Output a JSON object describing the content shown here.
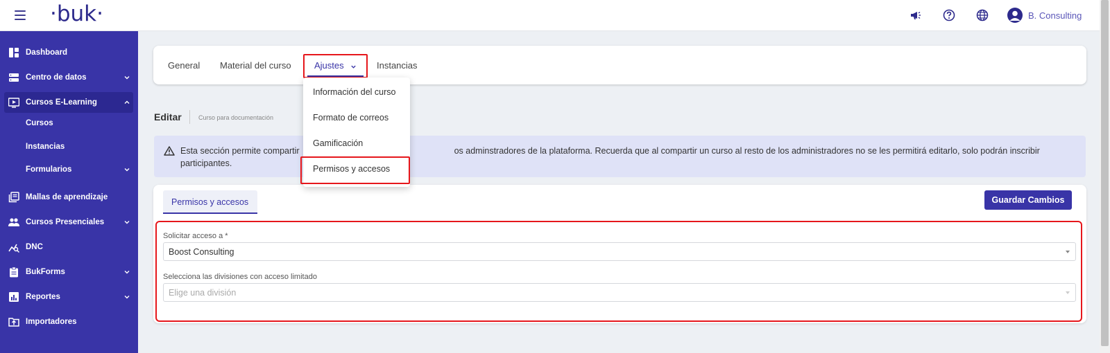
{
  "topbar": {
    "logo": "·buk·",
    "user": "B. Consulting"
  },
  "sidebar": {
    "items": [
      {
        "label": "Dashboard"
      },
      {
        "label": "Centro de datos"
      },
      {
        "label": "Cursos E-Learning"
      },
      {
        "label": "Cursos"
      },
      {
        "label": "Instancias"
      },
      {
        "label": "Formularios"
      },
      {
        "label": "Mallas de aprendizaje"
      },
      {
        "label": "Cursos Presenciales"
      },
      {
        "label": "DNC"
      },
      {
        "label": "BukForms"
      },
      {
        "label": "Reportes"
      },
      {
        "label": "Importadores"
      }
    ]
  },
  "tabs": {
    "general": "General",
    "material": "Material del curso",
    "ajustes": "Ajustes",
    "instancias": "Instancias"
  },
  "dropdown": {
    "items": [
      "Información del curso",
      "Formato de correos",
      "Gamificación",
      "Permisos y accesos"
    ]
  },
  "editar": {
    "title": "Editar",
    "subtitle": "Curso para documentación"
  },
  "alert": {
    "text_start": "Esta sección permite compartir",
    "text_end": "os adminstradores de la plataforma. Recuerda que al compartir un curso al resto de los administradores no se les permitirá editarlo, solo podrán inscribir",
    "text_line2": "participantes."
  },
  "permisos": {
    "tab": "Permisos y accesos",
    "save": "Guardar Cambios",
    "field1_label": "Solicitar acceso a *",
    "field1_value": "Boost Consulting",
    "field2_label": "Selecciona las divisiones con acceso limitado",
    "field2_placeholder": "Elige una división"
  },
  "colors": {
    "primary": "#3934a7",
    "highlight": "#e6161b",
    "alert_bg": "#dfe2f7"
  }
}
